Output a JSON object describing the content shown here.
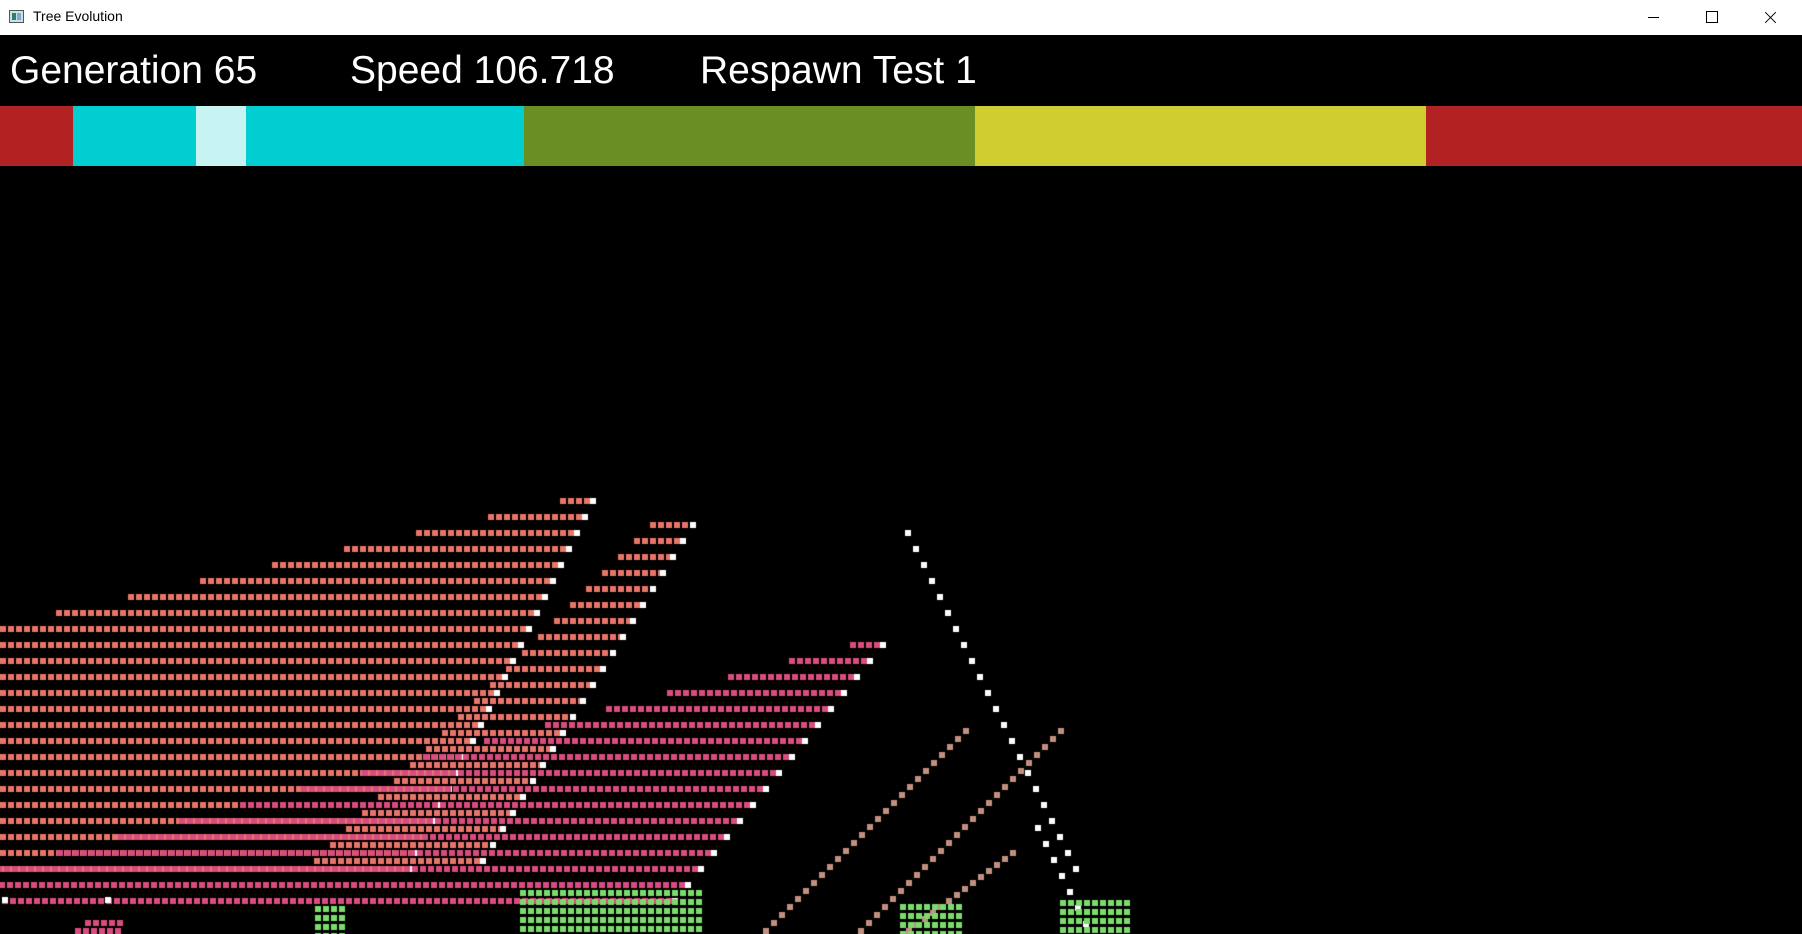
{
  "window": {
    "title": "Tree Evolution"
  },
  "hud": {
    "generation": "Generation 65",
    "speed": "Speed 106.718",
    "respawn": "Respawn Test 1"
  },
  "population_bar": {
    "colors": [
      "#b22222",
      "#00ced1",
      "#c8f3f3",
      "#00ced1",
      "#6b8e23",
      "#d0cd30",
      "#b22222"
    ],
    "shares": [
      0.0405,
      0.068,
      0.0275,
      0.1545,
      0.25,
      0.25,
      0.2095
    ]
  },
  "colors": {
    "leaf_salmon": "#e8746a",
    "leaf_pink": "#d94c7f",
    "leaf_green": "#7bdc6c",
    "stem_tan": "#c09080",
    "seed_white": "#ffffff",
    "background": "#000000"
  }
}
